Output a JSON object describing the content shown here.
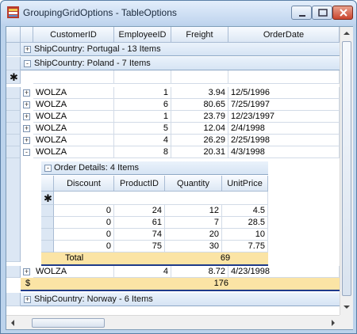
{
  "window": {
    "title": "GroupingGridOptions - TableOptions"
  },
  "columns": [
    "CustomerID",
    "EmployeeID",
    "Freight",
    "OrderDate"
  ],
  "groups": {
    "portugal": "ShipCountry: Portugal - 13 Items",
    "poland": "ShipCountry: Poland - 7 Items",
    "norway": "ShipCountry: Norway - 6 Items"
  },
  "rows": [
    {
      "customer": "WOLZA",
      "employee": "1",
      "freight": "3.94",
      "date": "12/5/1996"
    },
    {
      "customer": "WOLZA",
      "employee": "6",
      "freight": "80.65",
      "date": "7/25/1997"
    },
    {
      "customer": "WOLZA",
      "employee": "1",
      "freight": "23.79",
      "date": "12/23/1997"
    },
    {
      "customer": "WOLZA",
      "employee": "5",
      "freight": "12.04",
      "date": "2/4/1998"
    },
    {
      "customer": "WOLZA",
      "employee": "4",
      "freight": "26.29",
      "date": "2/25/1998"
    },
    {
      "customer": "WOLZA",
      "employee": "8",
      "freight": "20.31",
      "date": "4/3/1998"
    }
  ],
  "details": {
    "header": "Order Details: 4 Items",
    "columns": [
      "Discount",
      "ProductID",
      "Quantity",
      "UnitPrice"
    ],
    "rows": [
      {
        "discount": "0",
        "product": "24",
        "quantity": "12",
        "price": "4.5"
      },
      {
        "discount": "0",
        "product": "61",
        "quantity": "7",
        "price": "28.5"
      },
      {
        "discount": "0",
        "product": "74",
        "quantity": "20",
        "price": "10"
      },
      {
        "discount": "0",
        "product": "75",
        "quantity": "30",
        "price": "7.75"
      }
    ],
    "total_label": "Total",
    "total_value": "69"
  },
  "last_row": {
    "customer": "WOLZA",
    "employee": "4",
    "freight": "8.72",
    "date": "4/23/1998"
  },
  "group_summary": {
    "label": "$",
    "value": "176"
  },
  "icons": {
    "expand": "+",
    "collapse": "-",
    "new_row": "✱"
  }
}
